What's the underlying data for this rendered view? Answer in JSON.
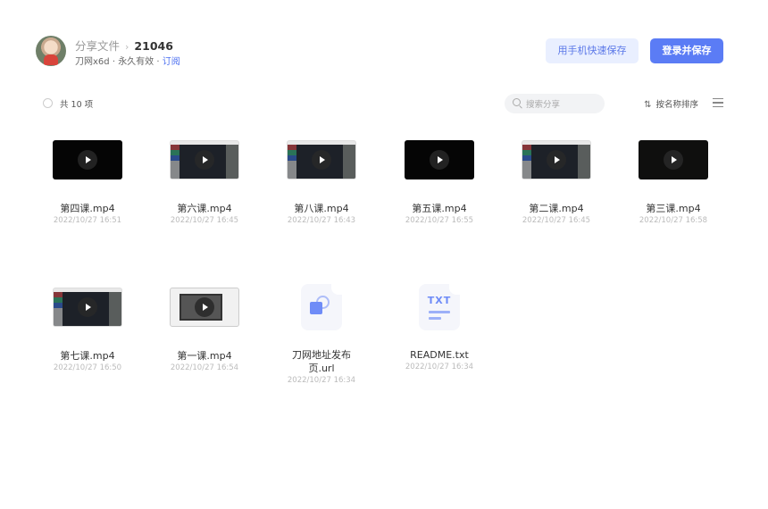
{
  "header": {
    "breadcrumb_root": "分享文件",
    "breadcrumb_sep": "›",
    "breadcrumb_current": "21046",
    "owner": "刀网x6d",
    "validity": "永久有效",
    "subscribe": "订阅",
    "btn_mobile_save": "用手机快速保存",
    "btn_login_save": "登录并保存"
  },
  "toolbar": {
    "count": "共 10 项",
    "search_placeholder": "搜索分享",
    "sort_label": "按名称排序",
    "sort_icon": "⇅"
  },
  "files": [
    {
      "name": "第四课.mp4",
      "date": "2022/10/27 16:51",
      "thumb": "black"
    },
    {
      "name": "第六课.mp4",
      "date": "2022/10/27 16:45",
      "thumb": "screen"
    },
    {
      "name": "第八课.mp4",
      "date": "2022/10/27 16:43",
      "thumb": "screen"
    },
    {
      "name": "第五课.mp4",
      "date": "2022/10/27 16:55",
      "thumb": "black"
    },
    {
      "name": "第二课.mp4",
      "date": "2022/10/27 16:45",
      "thumb": "screen"
    },
    {
      "name": "第三课.mp4",
      "date": "2022/10/27 16:58",
      "thumb": "dark"
    },
    {
      "name": "第七课.mp4",
      "date": "2022/10/27 16:50",
      "thumb": "screen"
    },
    {
      "name": "第一课.mp4",
      "date": "2022/10/27 16:54",
      "thumb": "light"
    },
    {
      "name": "刀网地址发布页.url",
      "date": "2022/10/27 16:34",
      "icon": "url-file-icon"
    },
    {
      "name": "README.txt",
      "date": "2022/10/27 16:34",
      "icon": "txt-file-icon",
      "icon_text": "TXT"
    }
  ]
}
